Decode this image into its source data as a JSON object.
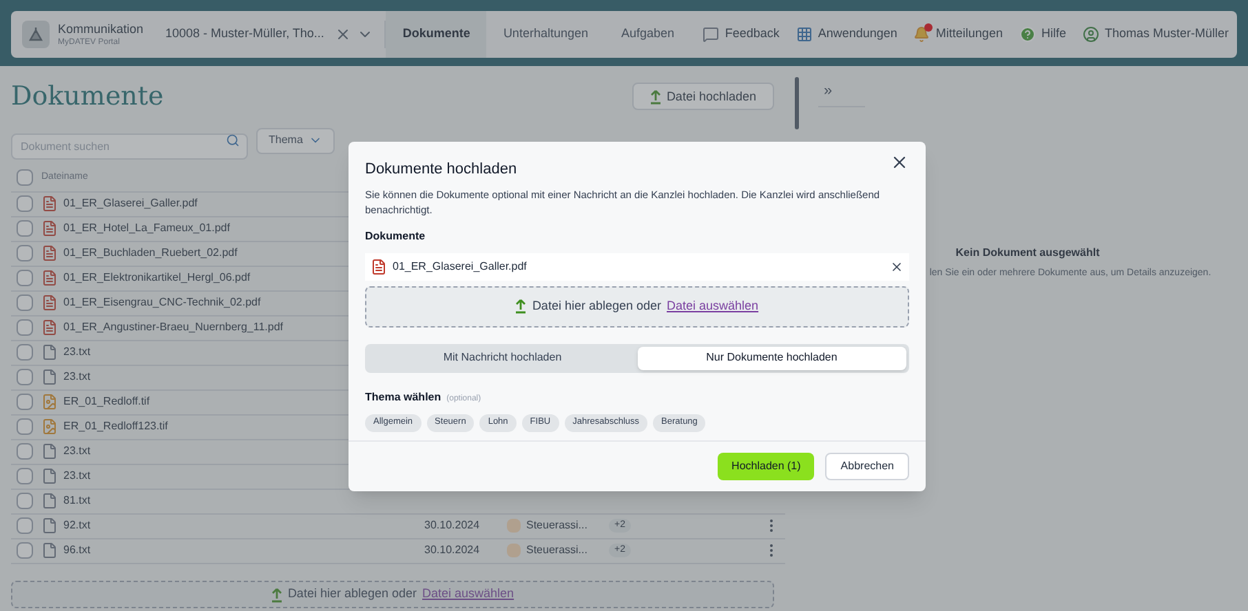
{
  "nav": {
    "app_title": "Kommunikation",
    "app_subtitle": "MyDATEV Portal",
    "client": "10008 - Muster-Müller, Tho...",
    "tabs": [
      {
        "label": "Dokumente",
        "selected": true
      },
      {
        "label": "Unterhaltungen",
        "selected": false
      },
      {
        "label": "Aufgaben",
        "selected": false
      }
    ],
    "actions": [
      {
        "kind": "feedback",
        "label": "Feedback"
      },
      {
        "kind": "apps",
        "label": "Anwendungen"
      },
      {
        "kind": "notifications",
        "label": "Mitteilungen"
      },
      {
        "kind": "help",
        "label": "Hilfe"
      },
      {
        "kind": "user",
        "label": "Thomas Muster-Müller"
      }
    ]
  },
  "documents": {
    "title": "Dokumente",
    "upload_button": "Datei hochladen",
    "search": {
      "placeholder": "Dokument suchen"
    },
    "topic_filter": "Thema",
    "column": "Dateiname",
    "all_checked": false,
    "files": [
      {
        "name": "01_ER_Glaserei_Galler.pdf",
        "kind": "pdf",
        "checked": false
      },
      {
        "name": "01_ER_Hotel_La_Fameux_01.pdf",
        "kind": "pdf",
        "checked": false
      },
      {
        "name": "01_ER_Buchladen_Ruebert_02.pdf",
        "kind": "pdf",
        "checked": false
      },
      {
        "name": "01_ER_Elektronikartikel_Hergl_06.pdf",
        "kind": "pdf",
        "checked": false
      },
      {
        "name": "01_ER_Eisengrau_CNC-Technik_02.pdf",
        "kind": "pdf",
        "checked": false
      },
      {
        "name": "01_ER_Angustiner-Braeu_Nuernberg_11.pdf",
        "kind": "pdf",
        "checked": false
      },
      {
        "name": "23.txt",
        "kind": "txt",
        "checked": false
      },
      {
        "name": "23.txt",
        "kind": "txt",
        "checked": false
      },
      {
        "name": "ER_01_Redloff.tif",
        "kind": "tif",
        "checked": false
      },
      {
        "name": "ER_01_Redloff123.tif",
        "kind": "tif",
        "checked": false
      },
      {
        "name": "23.txt",
        "kind": "txt",
        "checked": false
      },
      {
        "name": "23.txt",
        "kind": "txt",
        "checked": false
      },
      {
        "name": "81.txt",
        "kind": "txt",
        "checked": false
      },
      {
        "name": "92.txt",
        "kind": "txt",
        "checked": false,
        "date": "30.10.2024",
        "topic": "Steuerassi...",
        "extra": "+2"
      },
      {
        "name": "96.txt",
        "kind": "txt",
        "checked": false,
        "date": "30.10.2024",
        "topic": "Steuerassi...",
        "extra": "+2"
      }
    ],
    "dropzone": {
      "text": "Datei hier ablegen oder",
      "link": "Datei auswählen"
    }
  },
  "details": {
    "collapse": "»",
    "title": "Kein Dokument ausgewählt",
    "hint": "len Sie ein oder mehrere Dokumente aus, um Details anzuzeigen."
  },
  "dialog": {
    "title": "Dokumente hochladen",
    "description": "Sie können die Dokumente optional mit einer Nachricht an die Kanzlei hochladen. Die Kanzlei wird anschließend benachrichtigt.",
    "files_label": "Dokumente",
    "files": [
      {
        "name": "01_ER_Glaserei_Galler.pdf",
        "kind": "pdf"
      }
    ],
    "dropzone": {
      "text": "Datei hier ablegen oder",
      "link": "Datei auswählen"
    },
    "modes": [
      {
        "label": "Mit Nachricht hochladen",
        "selected": false
      },
      {
        "label": "Nur Dokumente hochladen",
        "selected": true
      }
    ],
    "topic_label": "Thema wählen",
    "topic_hint": "(optional)",
    "topics": [
      {
        "label": "Allgemein",
        "selected": false
      },
      {
        "label": "Steuern",
        "selected": false
      },
      {
        "label": "Lohn",
        "selected": false
      },
      {
        "label": "FIBU",
        "selected": false
      },
      {
        "label": "Jahresabschluss",
        "selected": false
      },
      {
        "label": "Beratung",
        "selected": false
      }
    ],
    "submit": "Hochladen (1)",
    "cancel": "Abbrechen"
  }
}
